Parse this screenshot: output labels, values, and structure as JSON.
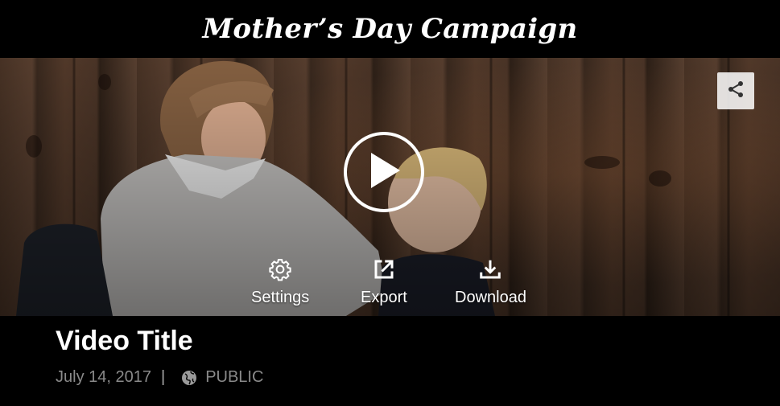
{
  "header": {
    "title": "Mother’s Day Campaign"
  },
  "video": {
    "title": "Video Title",
    "date": "July 14, 2017",
    "separator": "|",
    "visibility": "PUBLIC"
  },
  "actions": {
    "settings_label": "Settings",
    "export_label": "Export",
    "download_label": "Download"
  },
  "icons": [
    "share-icon",
    "play-icon",
    "gear-icon",
    "external-link-icon",
    "download-icon",
    "globe-icon"
  ]
}
